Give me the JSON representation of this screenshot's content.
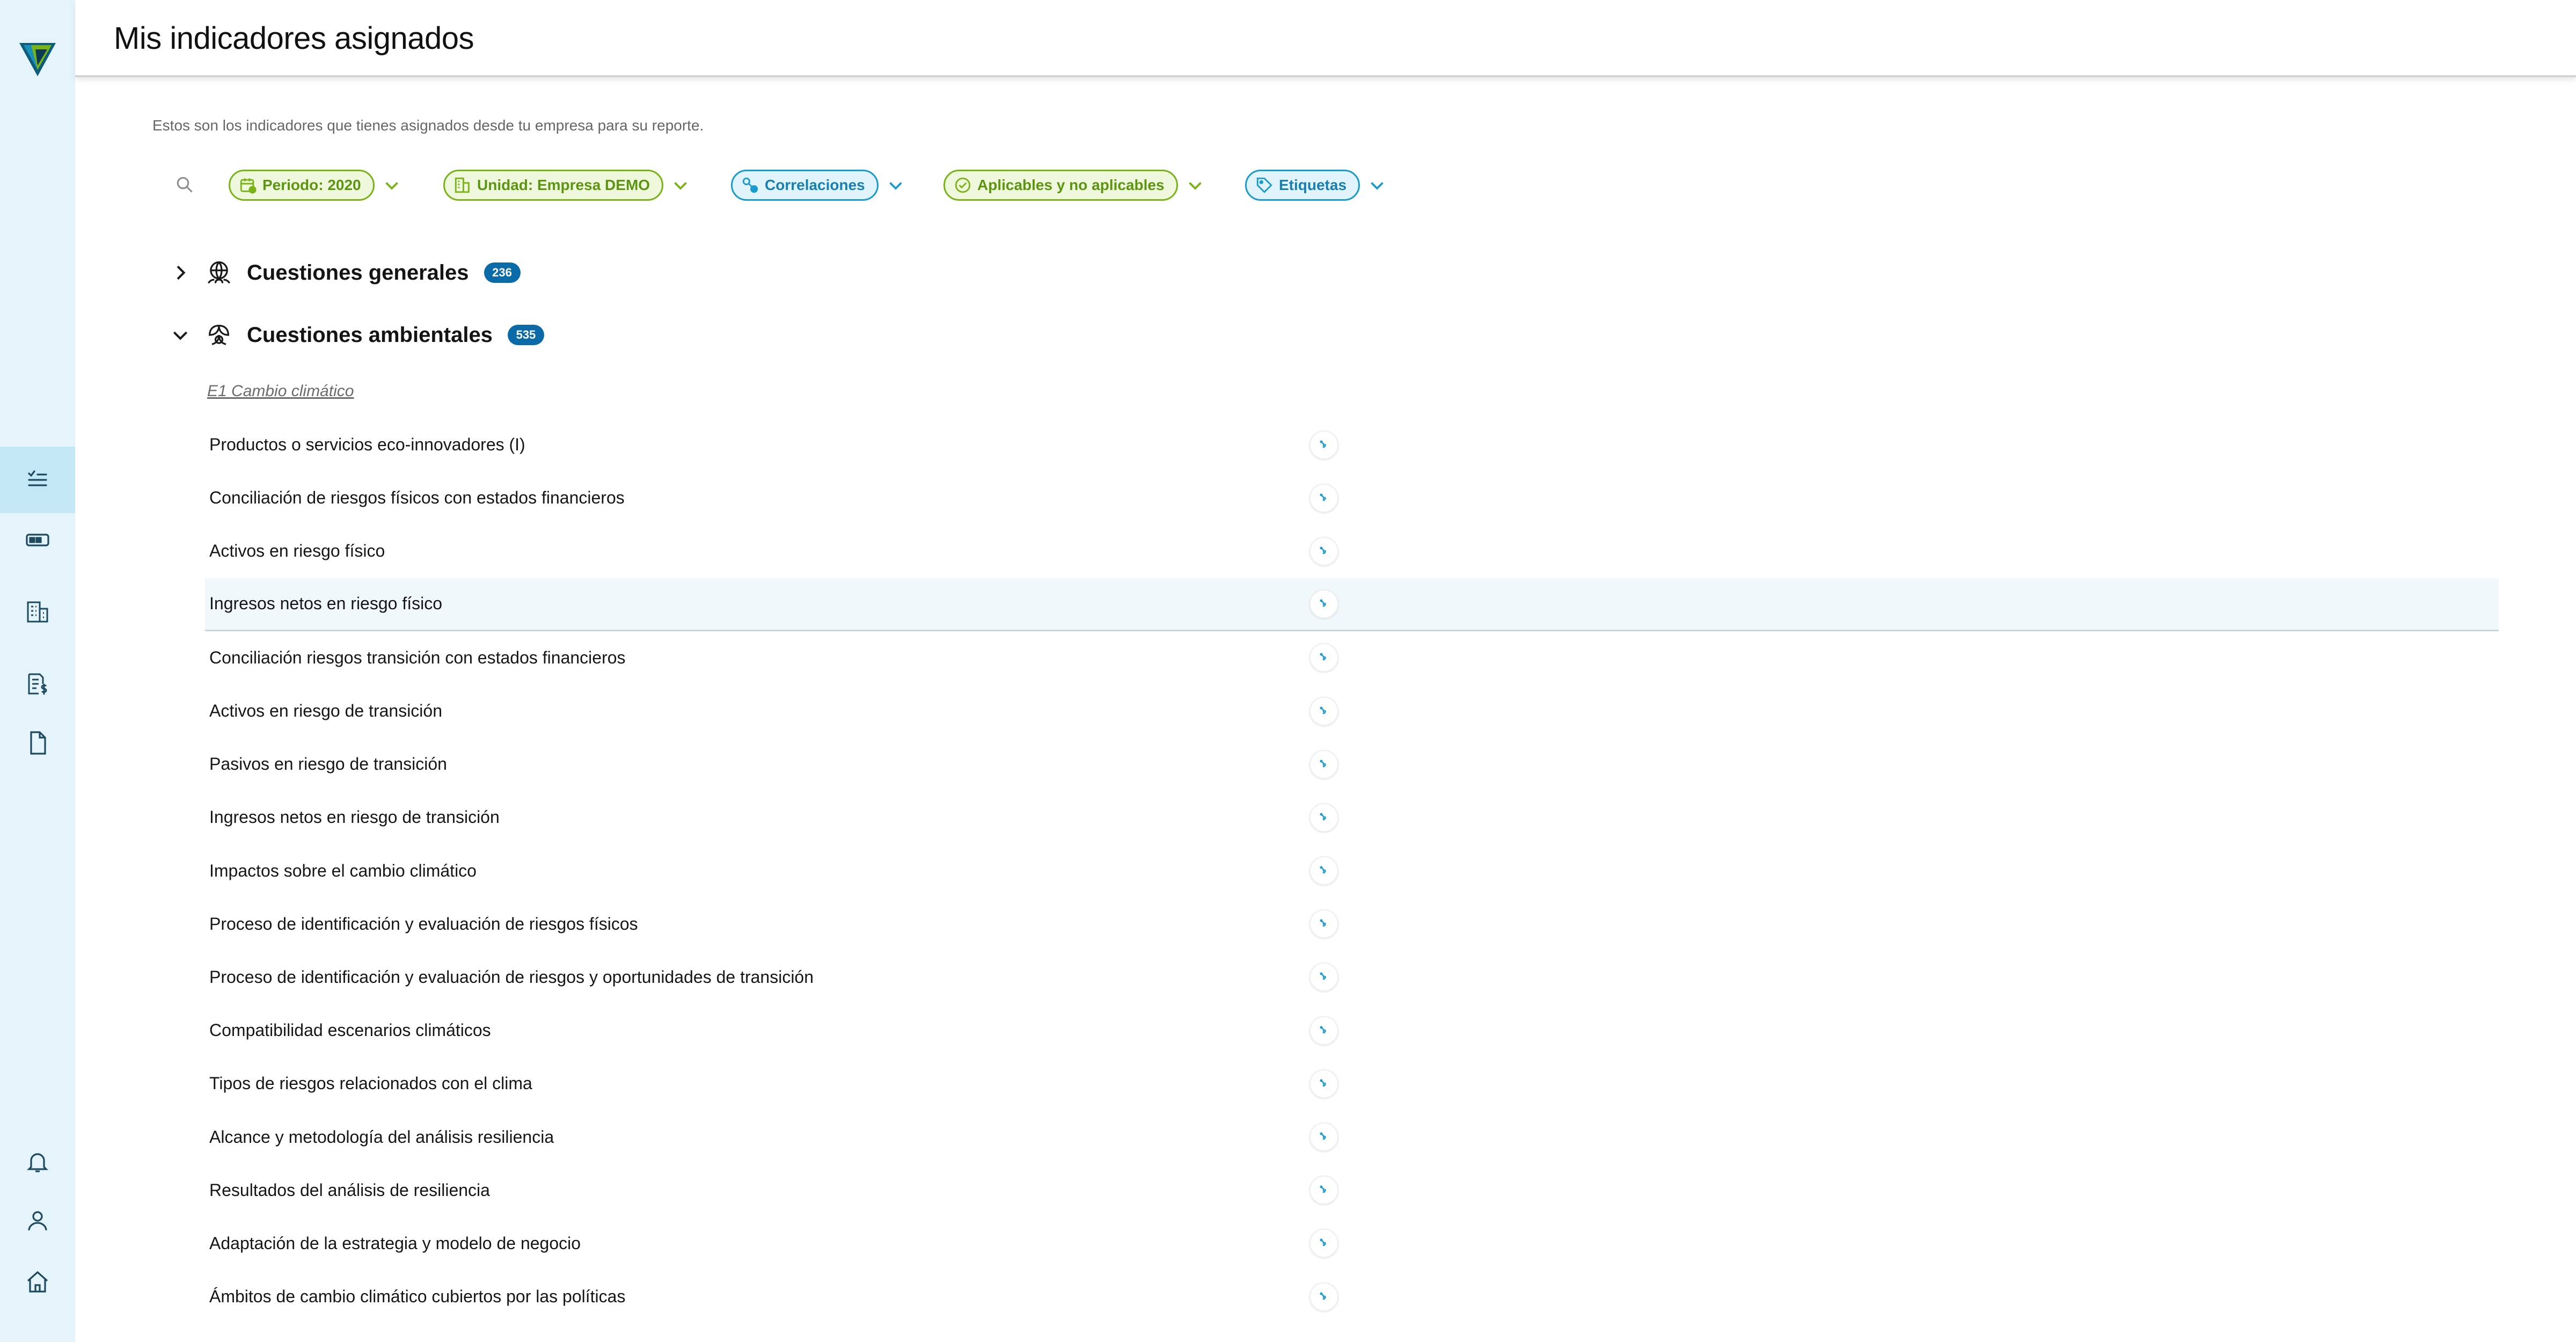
{
  "header": {
    "title": "Mis indicadores asignados"
  },
  "subtitle": "Estos son los indicadores que tienes asignados desde tu empresa para su reporte.",
  "filters": [
    {
      "label": "Periodo: 2020",
      "icon": "calendar-icon",
      "color": "#7ab317"
    },
    {
      "label": "Unidad: Empresa DEMO",
      "icon": "building-icon",
      "color": "#7ab317"
    },
    {
      "label": "Correlaciones",
      "icon": "correlation-icon",
      "color": "#1a9bd0"
    },
    {
      "label": "Aplicables y no aplicables",
      "icon": "check-circle-icon",
      "color": "#7ab317"
    },
    {
      "label": "Etiquetas",
      "icon": "tag-icon",
      "color": "#1a9bd0"
    }
  ],
  "sections": [
    {
      "title": "Cuestiones generales",
      "count": "236",
      "expanded": false,
      "icon": "globe-people-icon"
    },
    {
      "title": "Cuestiones ambientales",
      "count": "535",
      "expanded": true,
      "icon": "leaves-icon"
    }
  ],
  "subsection": "E1 Cambio climático",
  "indicators": [
    "Productos o servicios eco-innovadores (I)",
    "Conciliación de riesgos físicos con estados financieros",
    "Activos en riesgo físico",
    "Ingresos netos en riesgo físico",
    "Conciliación riesgos transición con estados financieros",
    "Activos en riesgo de transición",
    "Pasivos en riesgo de transición",
    "Ingresos netos en riesgo de transición",
    "Impactos sobre el cambio climático",
    "Proceso de identificación y evaluación de riesgos físicos",
    "Proceso de identificación y evaluación de riesgos y oportunidades de transición",
    "Compatibilidad escenarios climáticos",
    "Tipos de riesgos relacionados con el clima",
    "Alcance y metodología del análisis resiliencia",
    "Resultados del análisis de resiliencia",
    "Adaptación de la estrategia y modelo de negocio",
    "Ámbitos de cambio climático cubiertos por las políticas"
  ],
  "sidebar": {
    "items": [
      "checklist-icon",
      "id-card-icon",
      "buildings-icon",
      "invoice-icon",
      "document-icon"
    ],
    "bottom": [
      "bell-icon",
      "user-icon",
      "home-icon"
    ]
  },
  "colors": {
    "accent_green": "#7ab317",
    "accent_blue": "#1a9bd0",
    "badge": "#0b6aa8",
    "sidebar_bg": "#e5f4fb"
  }
}
